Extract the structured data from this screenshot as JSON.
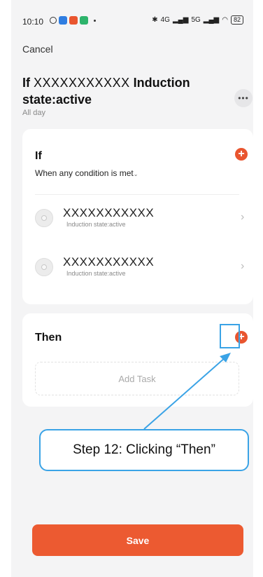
{
  "status_bar": {
    "time": "10:10",
    "network_left": "4G",
    "network_right": "5G",
    "battery": "82"
  },
  "header": {
    "cancel_label": "Cancel",
    "title_prefix": "If",
    "title_device": "XXXXXXXXXXX",
    "title_suffix": "Induction state:active",
    "subtitle": "All day",
    "more_label": "•••"
  },
  "if_section": {
    "title": "If",
    "condition_mode": "When any condition is met",
    "conditions": [
      {
        "name": "XXXXXXXXXXX",
        "state": "Induction state:active"
      },
      {
        "name": "XXXXXXXXXXX",
        "state": "Induction state:active"
      }
    ]
  },
  "then_section": {
    "title": "Then",
    "add_task_label": "Add Task"
  },
  "save_label": "Save",
  "annotation": {
    "text": "Step 12: Clicking “Then”"
  },
  "colors": {
    "accent": "#ec5a31",
    "annotation": "#3aa3e6"
  }
}
